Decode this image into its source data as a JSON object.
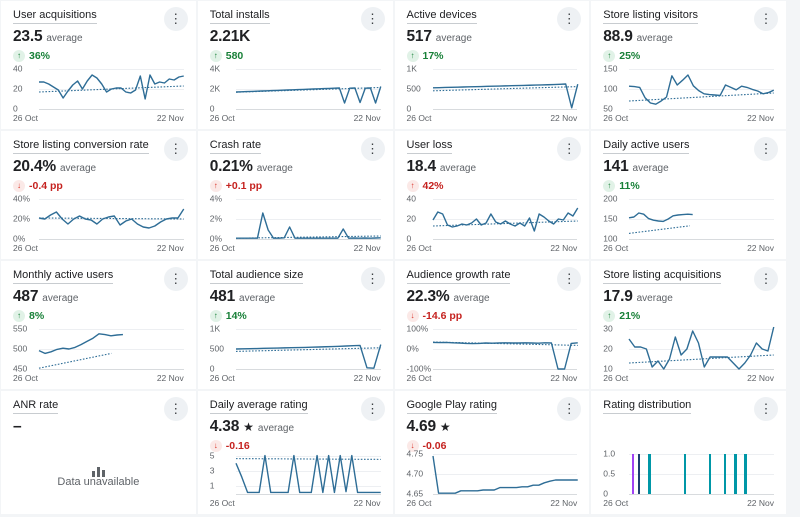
{
  "icons": {
    "kebab": "⋮"
  },
  "colors": {
    "line": "#2e6d96",
    "grid": "#edeff2",
    "axis": "#d8dbde",
    "green_text": "#188038",
    "red_text": "#c5221f",
    "bar_purple": "#a142f4",
    "bar_navy": "#1c3e6e",
    "bar_teal": "#0097a7"
  },
  "cards": [
    {
      "title": "User acquisitions",
      "value": "23.5",
      "star": "",
      "suffix": "average",
      "badge": {
        "arrow": "↑",
        "text": "36%",
        "tone": "good"
      },
      "chart": {
        "type": "line",
        "ymin": 0,
        "ymax": 40,
        "ticks": [
          {
            "label": "40",
            "v": 40
          },
          {
            "label": "20",
            "v": 20
          },
          {
            "label": "0",
            "v": 0
          }
        ],
        "series": [
          27,
          27,
          25,
          22,
          19,
          11,
          18,
          24,
          28,
          20,
          28,
          34,
          31,
          25,
          17,
          20,
          21,
          21,
          17,
          16,
          19,
          33,
          10,
          34,
          25,
          27,
          26,
          30,
          29,
          32,
          33
        ],
        "span": 1,
        "trend": {
          "y0": 17,
          "y1": 23,
          "span": 1
        },
        "x_start": "26 Oct",
        "x_end": "22 Nov"
      }
    },
    {
      "title": "Total installs",
      "value": "2.21K",
      "star": "",
      "suffix": "",
      "badge": {
        "arrow": "↑",
        "text": "580",
        "tone": "good"
      },
      "chart": {
        "type": "line",
        "ymin": 0,
        "ymax": 4000,
        "ticks": [
          {
            "label": "4K",
            "v": 4000
          },
          {
            "label": "2K",
            "v": 2000
          },
          {
            "label": "0",
            "v": 0
          }
        ],
        "series": [
          1700,
          1720,
          1740,
          1760,
          1780,
          1800,
          1820,
          1840,
          1860,
          1880,
          1900,
          1920,
          1940,
          1960,
          1980,
          2000,
          2020,
          2040,
          2060,
          2080,
          2100,
          600,
          2080,
          2100,
          650,
          2080,
          2100,
          600,
          2250
        ],
        "span": 1,
        "trend": {
          "y0": 1680,
          "y1": 2150,
          "span": 1
        },
        "x_start": "26 Oct",
        "x_end": "22 Nov"
      }
    },
    {
      "title": "Active devices",
      "value": "517",
      "star": "",
      "suffix": "average",
      "badge": {
        "arrow": "↑",
        "text": "17%",
        "tone": "good"
      },
      "chart": {
        "type": "line",
        "ymin": 0,
        "ymax": 1000,
        "ticks": [
          {
            "label": "1K",
            "v": 1000
          },
          {
            "label": "500",
            "v": 500
          },
          {
            "label": "0",
            "v": 0
          }
        ],
        "series": [
          530,
          534,
          538,
          542,
          546,
          550,
          554,
          558,
          562,
          566,
          570,
          574,
          578,
          582,
          586,
          590,
          594,
          598,
          602,
          606,
          612,
          618,
          625,
          30,
          620
        ],
        "span": 1,
        "trend": {
          "y0": 455,
          "y1": 560,
          "span": 1
        },
        "x_start": "26 Oct",
        "x_end": "22 Nov"
      }
    },
    {
      "title": "Store listing visitors",
      "value": "88.9",
      "star": "",
      "suffix": "average",
      "badge": {
        "arrow": "↑",
        "text": "25%",
        "tone": "good"
      },
      "chart": {
        "type": "line",
        "ymin": 50,
        "ymax": 150,
        "ticks": [
          {
            "label": "150",
            "v": 150
          },
          {
            "label": "100",
            "v": 100
          },
          {
            "label": "50",
            "v": 50
          }
        ],
        "series": [
          107,
          106,
          104,
          78,
          65,
          62,
          70,
          80,
          133,
          110,
          122,
          135,
          108,
          96,
          88,
          86,
          85,
          84,
          110,
          104,
          98,
          107,
          104,
          99,
          95,
          88,
          91,
          97
        ],
        "span": 1,
        "trend": {
          "y0": 70,
          "y1": 90,
          "span": 1
        },
        "x_start": "26 Oct",
        "x_end": "22 Nov"
      }
    },
    {
      "title": "Store listing conversion rate",
      "value": "20.4%",
      "star": "",
      "suffix": "average",
      "badge": {
        "arrow": "↓",
        "text": "-0.4 pp",
        "tone": "bad"
      },
      "chart": {
        "type": "line",
        "ymin": 0,
        "ymax": 40,
        "ticks": [
          {
            "label": "40%",
            "v": 40
          },
          {
            "label": "20%",
            "v": 20
          },
          {
            "label": "0%",
            "v": 0
          }
        ],
        "series": [
          21,
          20,
          24,
          27,
          20,
          15,
          20,
          23,
          20,
          19,
          15,
          20,
          22,
          23,
          14,
          18,
          20,
          15,
          12,
          11,
          13,
          17,
          20,
          21,
          21,
          30
        ],
        "span": 1,
        "trend": {
          "y0": 21,
          "y1": 20,
          "span": 1
        },
        "x_start": "26 Oct",
        "x_end": "22 Nov"
      }
    },
    {
      "title": "Crash rate",
      "value": "0.21%",
      "star": "",
      "suffix": "average",
      "badge": {
        "arrow": "↑",
        "text": "+0.1 pp",
        "tone": "bad"
      },
      "chart": {
        "type": "line",
        "ymin": 0,
        "ymax": 4,
        "ticks": [
          {
            "label": "4%",
            "v": 4
          },
          {
            "label": "2%",
            "v": 2
          },
          {
            "label": "0%",
            "v": 0
          }
        ],
        "series": [
          0.08,
          0.08,
          0.08,
          0.08,
          0.08,
          2.6,
          0.9,
          0.08,
          0.08,
          0.12,
          1.2,
          0.08,
          0.08,
          0.08,
          0.08,
          0.08,
          0.08,
          0.08,
          0.08,
          0.08,
          1.0,
          0.08,
          0.1,
          0.08,
          0.1,
          0.08,
          0.1,
          0.12
        ],
        "span": 1,
        "trend": {
          "y0": 0.08,
          "y1": 0.3,
          "span": 1
        },
        "x_start": "26 Oct",
        "x_end": "22 Nov"
      }
    },
    {
      "title": "User loss",
      "value": "18.4",
      "star": "",
      "suffix": "average",
      "badge": {
        "arrow": "↑",
        "text": "42%",
        "tone": "bad"
      },
      "chart": {
        "type": "line",
        "ymin": 0,
        "ymax": 40,
        "ticks": [
          {
            "label": "40",
            "v": 40
          },
          {
            "label": "20",
            "v": 20
          },
          {
            "label": "0",
            "v": 0
          }
        ],
        "series": [
          19,
          27,
          25,
          14,
          12,
          13,
          15,
          14,
          16,
          20,
          14,
          16,
          25,
          17,
          15,
          18,
          15,
          13,
          16,
          13,
          21,
          8,
          25,
          22,
          18,
          15,
          20,
          19,
          26,
          23,
          31
        ],
        "span": 1,
        "trend": {
          "y0": 13,
          "y1": 18,
          "span": 1
        },
        "x_start": "26 Oct",
        "x_end": "22 Nov"
      }
    },
    {
      "title": "Daily active users",
      "value": "141",
      "star": "",
      "suffix": "average",
      "badge": {
        "arrow": "↑",
        "text": "11%",
        "tone": "good"
      },
      "chart": {
        "type": "line",
        "ymin": 100,
        "ymax": 200,
        "ticks": [
          {
            "label": "200",
            "v": 200
          },
          {
            "label": "150",
            "v": 150
          },
          {
            "label": "100",
            "v": 100
          }
        ],
        "series": [
          153,
          155,
          165,
          162,
          151,
          147,
          145,
          144,
          150,
          158,
          160,
          161,
          162,
          161
        ],
        "span": 0.44,
        "trend": {
          "y0": 114,
          "y1": 133,
          "span": 0.42
        },
        "x_start": "26 Oct",
        "x_end": "22 Nov"
      }
    },
    {
      "title": "Monthly active users",
      "value": "487",
      "star": "",
      "suffix": "average",
      "badge": {
        "arrow": "↑",
        "text": "8%",
        "tone": "good"
      },
      "chart": {
        "type": "line",
        "ymin": 450,
        "ymax": 550,
        "ticks": [
          {
            "label": "550",
            "v": 550
          },
          {
            "label": "500",
            "v": 500
          },
          {
            "label": "450",
            "v": 450
          }
        ],
        "series": [
          496,
          489,
          493,
          499,
          502,
          500,
          504,
          511,
          519,
          527,
          538,
          536,
          533,
          535,
          536
        ],
        "span": 0.58,
        "trend": {
          "y0": 452,
          "y1": 489,
          "span": 0.5
        },
        "x_start": "26 Oct",
        "x_end": "22 Nov"
      }
    },
    {
      "title": "Total audience size",
      "value": "481",
      "star": "",
      "suffix": "average",
      "badge": {
        "arrow": "↑",
        "text": "14%",
        "tone": "good"
      },
      "chart": {
        "type": "line",
        "ymin": 0,
        "ymax": 1000,
        "ticks": [
          {
            "label": "1K",
            "v": 1000
          },
          {
            "label": "500",
            "v": 500
          },
          {
            "label": "0",
            "v": 0
          }
        ],
        "series": [
          500,
          504,
          508,
          512,
          516,
          520,
          524,
          528,
          532,
          536,
          540,
          545,
          550,
          556,
          562,
          568,
          575,
          582,
          590,
          30,
          20,
          610
        ],
        "span": 1,
        "trend": {
          "y0": 440,
          "y1": 530,
          "span": 1
        },
        "x_start": "26 Oct",
        "x_end": "22 Nov"
      }
    },
    {
      "title": "Audience growth rate",
      "value": "22.3%",
      "star": "",
      "suffix": "average",
      "badge": {
        "arrow": "↓",
        "text": "-14.6 pp",
        "tone": "bad"
      },
      "chart": {
        "type": "line",
        "ymin": -100,
        "ymax": 100,
        "ticks": [
          {
            "label": "100%",
            "v": 100
          },
          {
            "label": "0%",
            "v": 0
          },
          {
            "label": "-100%",
            "v": -100
          }
        ],
        "series": [
          33,
          32,
          33,
          31,
          30,
          28,
          27,
          28,
          30,
          29,
          30,
          31,
          30,
          30,
          31,
          30,
          29,
          31,
          30,
          -100,
          -100,
          28,
          31
        ],
        "span": 1,
        "trend": {
          "y0": 35,
          "y1": 18,
          "span": 1
        },
        "x_start": "26 Oct",
        "x_end": "22 Nov"
      }
    },
    {
      "title": "Store listing acquisitions",
      "value": "17.9",
      "star": "",
      "suffix": "average",
      "badge": {
        "arrow": "↑",
        "text": "21%",
        "tone": "good"
      },
      "chart": {
        "type": "line",
        "ymin": 10,
        "ymax": 30,
        "ticks": [
          {
            "label": "30",
            "v": 30
          },
          {
            "label": "20",
            "v": 20
          },
          {
            "label": "10",
            "v": 10
          }
        ],
        "series": [
          25,
          21,
          21,
          20,
          11,
          14,
          10,
          15,
          26,
          17,
          20,
          29,
          23,
          11,
          16,
          16,
          16,
          16,
          13,
          10,
          13,
          17,
          23,
          20,
          19,
          31
        ],
        "span": 1,
        "trend": {
          "y0": 13,
          "y1": 17,
          "span": 1
        },
        "x_start": "26 Oct",
        "x_end": "22 Nov"
      }
    },
    {
      "title": "ANR rate",
      "value": "–",
      "star": "",
      "suffix": "",
      "badge": null,
      "chart": null,
      "unavailable": {
        "text": "Data unavailable"
      }
    },
    {
      "title": "Daily average rating",
      "value": "4.38",
      "star": "★",
      "suffix": "average",
      "badge": {
        "arrow": "↓",
        "text": "-0.16",
        "tone": "bad"
      },
      "chart": {
        "type": "line",
        "ymin": 0,
        "ymax": 5.2,
        "ticks": [
          {
            "label": "5",
            "v": 5
          },
          {
            "label": "3",
            "v": 3
          },
          {
            "label": "1",
            "v": 1
          }
        ],
        "series": [
          4.0,
          2.2,
          0.2,
          0.2,
          0.2,
          5,
          0.2,
          0.2,
          0.2,
          0.2,
          5,
          0.2,
          0.2,
          0.2,
          5,
          0.2,
          5,
          0.2,
          5,
          0.3,
          5,
          0.2,
          0.2,
          0.2,
          0.2,
          0.2
        ],
        "span": 1,
        "trend": {
          "y0": 4.6,
          "y1": 4.5,
          "span": 1
        },
        "x_start": "26 Oct",
        "x_end": "22 Nov"
      }
    },
    {
      "title": "Google Play rating",
      "value": "4.69",
      "star": "★",
      "suffix": "",
      "badge": {
        "arrow": "↓",
        "text": "-0.06",
        "tone": "bad"
      },
      "chart": {
        "type": "line",
        "ymin": 4.65,
        "ymax": 4.75,
        "ticks": [
          {
            "label": "4.75",
            "v": 4.75
          },
          {
            "label": "4.70",
            "v": 4.7
          },
          {
            "label": "4.65",
            "v": 4.65
          }
        ],
        "series": [
          4.745,
          4.652,
          4.652,
          4.652,
          4.652,
          4.658,
          4.658,
          4.658,
          4.658,
          4.66,
          4.66,
          4.66,
          4.666,
          4.666,
          4.666,
          4.666,
          4.668,
          4.668,
          4.672,
          4.672,
          4.678,
          4.682,
          4.685,
          4.685,
          4.685,
          4.685,
          4.685
        ],
        "span": 1,
        "trend": null,
        "x_start": "26 Oct",
        "x_end": "22 Nov"
      }
    },
    {
      "title": "Rating distribution",
      "value": null,
      "star": "",
      "suffix": "",
      "badge": null,
      "chart": {
        "type": "bar",
        "ymin": 0,
        "ymax": 1,
        "ticks": [
          {
            "label": "1.0",
            "v": 1
          },
          {
            "label": "0.5",
            "v": 0.5
          },
          {
            "label": "0",
            "v": 0
          }
        ],
        "bars": [
          {
            "x": 1.6,
            "v": 1,
            "color": "#a142f4"
          },
          {
            "x": 6.0,
            "v": 1,
            "color": "#1c3e6e"
          },
          {
            "x": 13.0,
            "v": 1,
            "color": "#0097a7"
          },
          {
            "x": 37.5,
            "v": 1,
            "color": "#0097a7"
          },
          {
            "x": 54.9,
            "v": 1,
            "color": "#0097a7"
          },
          {
            "x": 65.2,
            "v": 1,
            "color": "#0097a7"
          },
          {
            "x": 72.6,
            "v": 1,
            "color": "#0097a7"
          },
          {
            "x": 79.4,
            "v": 1,
            "color": "#0097a7"
          }
        ],
        "x_start": "26 Oct",
        "x_end": "22 Nov"
      }
    }
  ]
}
